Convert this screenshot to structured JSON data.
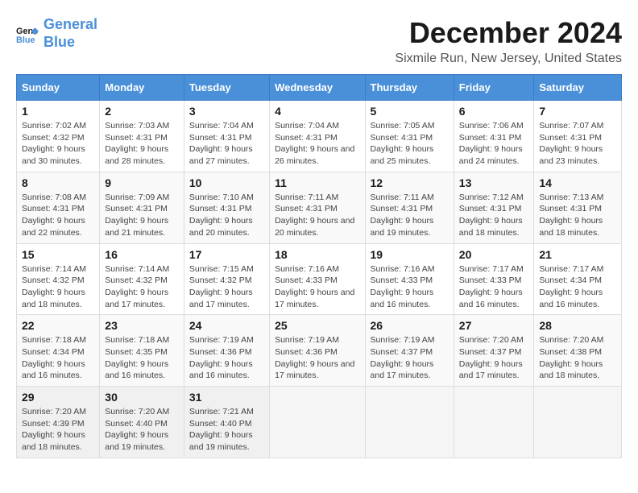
{
  "header": {
    "logo_line1": "General",
    "logo_line2": "Blue",
    "title": "December 2024",
    "subtitle": "Sixmile Run, New Jersey, United States"
  },
  "days_of_week": [
    "Sunday",
    "Monday",
    "Tuesday",
    "Wednesday",
    "Thursday",
    "Friday",
    "Saturday"
  ],
  "weeks": [
    [
      {
        "day": "1",
        "sunrise": "7:02 AM",
        "sunset": "4:32 PM",
        "daylight": "9 hours and 30 minutes."
      },
      {
        "day": "2",
        "sunrise": "7:03 AM",
        "sunset": "4:31 PM",
        "daylight": "9 hours and 28 minutes."
      },
      {
        "day": "3",
        "sunrise": "7:04 AM",
        "sunset": "4:31 PM",
        "daylight": "9 hours and 27 minutes."
      },
      {
        "day": "4",
        "sunrise": "7:04 AM",
        "sunset": "4:31 PM",
        "daylight": "9 hours and 26 minutes."
      },
      {
        "day": "5",
        "sunrise": "7:05 AM",
        "sunset": "4:31 PM",
        "daylight": "9 hours and 25 minutes."
      },
      {
        "day": "6",
        "sunrise": "7:06 AM",
        "sunset": "4:31 PM",
        "daylight": "9 hours and 24 minutes."
      },
      {
        "day": "7",
        "sunrise": "7:07 AM",
        "sunset": "4:31 PM",
        "daylight": "9 hours and 23 minutes."
      }
    ],
    [
      {
        "day": "8",
        "sunrise": "7:08 AM",
        "sunset": "4:31 PM",
        "daylight": "9 hours and 22 minutes."
      },
      {
        "day": "9",
        "sunrise": "7:09 AM",
        "sunset": "4:31 PM",
        "daylight": "9 hours and 21 minutes."
      },
      {
        "day": "10",
        "sunrise": "7:10 AM",
        "sunset": "4:31 PM",
        "daylight": "9 hours and 20 minutes."
      },
      {
        "day": "11",
        "sunrise": "7:11 AM",
        "sunset": "4:31 PM",
        "daylight": "9 hours and 20 minutes."
      },
      {
        "day": "12",
        "sunrise": "7:11 AM",
        "sunset": "4:31 PM",
        "daylight": "9 hours and 19 minutes."
      },
      {
        "day": "13",
        "sunrise": "7:12 AM",
        "sunset": "4:31 PM",
        "daylight": "9 hours and 18 minutes."
      },
      {
        "day": "14",
        "sunrise": "7:13 AM",
        "sunset": "4:31 PM",
        "daylight": "9 hours and 18 minutes."
      }
    ],
    [
      {
        "day": "15",
        "sunrise": "7:14 AM",
        "sunset": "4:32 PM",
        "daylight": "9 hours and 18 minutes."
      },
      {
        "day": "16",
        "sunrise": "7:14 AM",
        "sunset": "4:32 PM",
        "daylight": "9 hours and 17 minutes."
      },
      {
        "day": "17",
        "sunrise": "7:15 AM",
        "sunset": "4:32 PM",
        "daylight": "9 hours and 17 minutes."
      },
      {
        "day": "18",
        "sunrise": "7:16 AM",
        "sunset": "4:33 PM",
        "daylight": "9 hours and 17 minutes."
      },
      {
        "day": "19",
        "sunrise": "7:16 AM",
        "sunset": "4:33 PM",
        "daylight": "9 hours and 16 minutes."
      },
      {
        "day": "20",
        "sunrise": "7:17 AM",
        "sunset": "4:33 PM",
        "daylight": "9 hours and 16 minutes."
      },
      {
        "day": "21",
        "sunrise": "7:17 AM",
        "sunset": "4:34 PM",
        "daylight": "9 hours and 16 minutes."
      }
    ],
    [
      {
        "day": "22",
        "sunrise": "7:18 AM",
        "sunset": "4:34 PM",
        "daylight": "9 hours and 16 minutes."
      },
      {
        "day": "23",
        "sunrise": "7:18 AM",
        "sunset": "4:35 PM",
        "daylight": "9 hours and 16 minutes."
      },
      {
        "day": "24",
        "sunrise": "7:19 AM",
        "sunset": "4:36 PM",
        "daylight": "9 hours and 16 minutes."
      },
      {
        "day": "25",
        "sunrise": "7:19 AM",
        "sunset": "4:36 PM",
        "daylight": "9 hours and 17 minutes."
      },
      {
        "day": "26",
        "sunrise": "7:19 AM",
        "sunset": "4:37 PM",
        "daylight": "9 hours and 17 minutes."
      },
      {
        "day": "27",
        "sunrise": "7:20 AM",
        "sunset": "4:37 PM",
        "daylight": "9 hours and 17 minutes."
      },
      {
        "day": "28",
        "sunrise": "7:20 AM",
        "sunset": "4:38 PM",
        "daylight": "9 hours and 18 minutes."
      }
    ],
    [
      {
        "day": "29",
        "sunrise": "7:20 AM",
        "sunset": "4:39 PM",
        "daylight": "9 hours and 18 minutes."
      },
      {
        "day": "30",
        "sunrise": "7:20 AM",
        "sunset": "4:40 PM",
        "daylight": "9 hours and 19 minutes."
      },
      {
        "day": "31",
        "sunrise": "7:21 AM",
        "sunset": "4:40 PM",
        "daylight": "9 hours and 19 minutes."
      },
      null,
      null,
      null,
      null
    ]
  ],
  "labels": {
    "sunrise": "Sunrise:",
    "sunset": "Sunset:",
    "daylight": "Daylight:"
  }
}
